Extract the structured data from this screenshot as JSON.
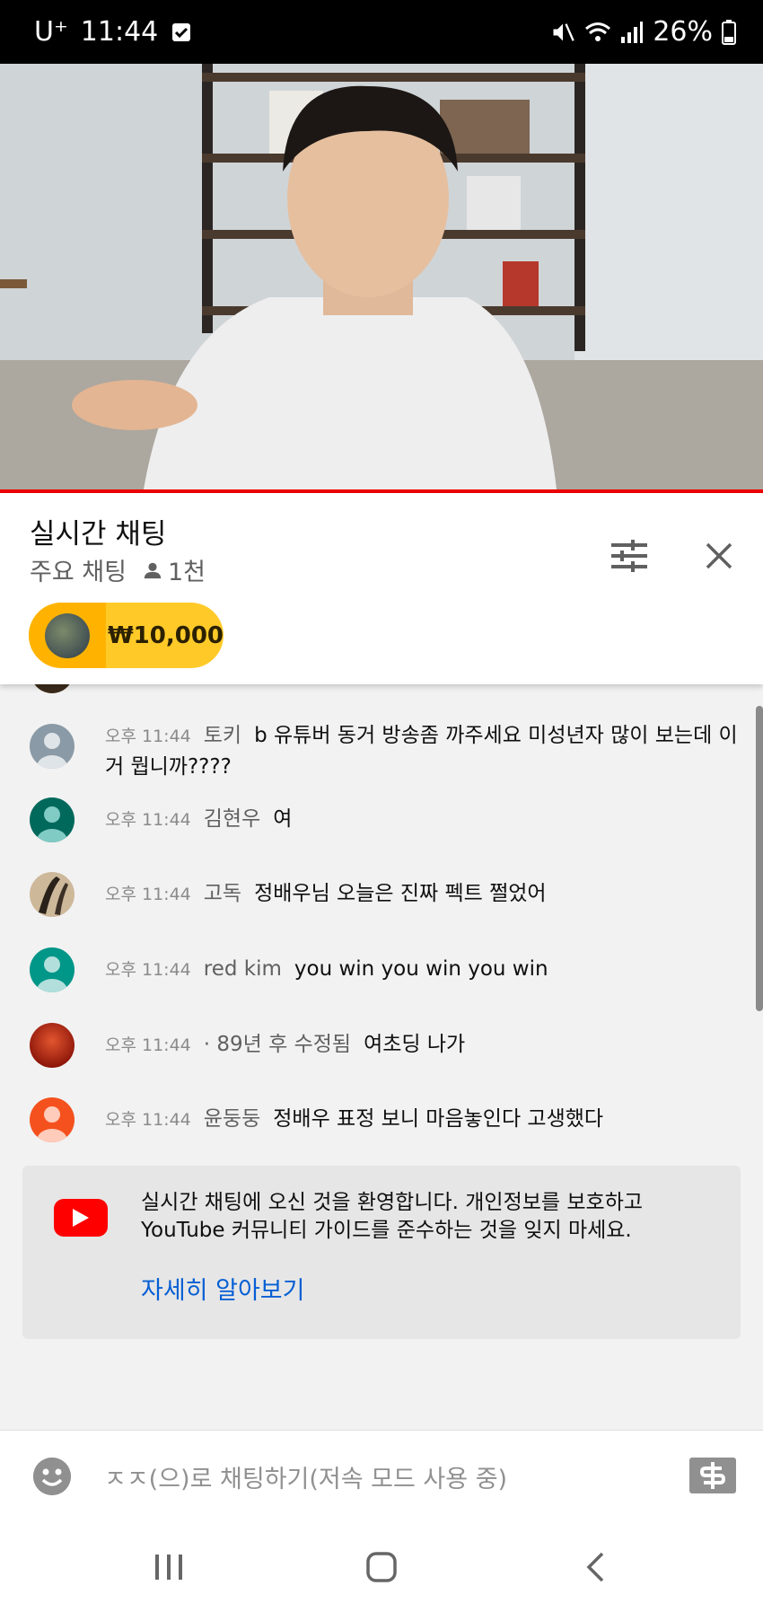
{
  "status_bar": {
    "carrier": "U⁺",
    "time": "11:44",
    "battery": "26%"
  },
  "chat_header": {
    "title": "실시간 채팅",
    "mode": "주요 채팅",
    "viewers": "1천"
  },
  "superchat": {
    "amount": "₩10,000",
    "color": "#ffca28"
  },
  "messages": [
    {
      "time": "오후 11:44",
      "author": "토키",
      "text": "b 유튜버 동거 방송좀 까주세요 미성년자 많이 보는데 이거 뭡니까????",
      "avatar_color": "#8a9aa6"
    },
    {
      "time": "오후 11:44",
      "author": "김현우",
      "text": "여",
      "avatar_color": "#00695c"
    },
    {
      "time": "오후 11:44",
      "author": "고독",
      "text": "정배우님 오늘은 진짜 펙트 쩔었어",
      "avatar_color": "#bfa88a"
    },
    {
      "time": "오후 11:44",
      "author": "red kim",
      "text": "you win you win you win",
      "avatar_color": "#009688"
    },
    {
      "time": "오후 11:44",
      "author": "· 89년 후 수정됨",
      "text": "여초딩 나가",
      "avatar_color": "#b3261e"
    },
    {
      "time": "오후 11:44",
      "author": "윤둥둥",
      "text": "정배우 표정 보니 마음놓인다 고생했다",
      "avatar_color": "#f4511e"
    }
  ],
  "welcome": {
    "text": "실시간 채팅에 오신 것을 환영합니다. 개인정보를 보호하고 YouTube 커뮤니티 가이드를 준수하는 것을 잊지 마세요.",
    "link": "자세히 알아보기"
  },
  "input": {
    "placeholder": "ㅈㅈ(으)로 채팅하기(저속 모드 사용 중)"
  },
  "icons": {
    "mute": "mute-icon",
    "wifi": "wifi-icon",
    "signal": "signal-icon",
    "battery": "battery-icon",
    "filter": "filter-icon",
    "close": "close-icon",
    "emoji": "emoji-icon",
    "super_chat": "dollar-icon"
  }
}
